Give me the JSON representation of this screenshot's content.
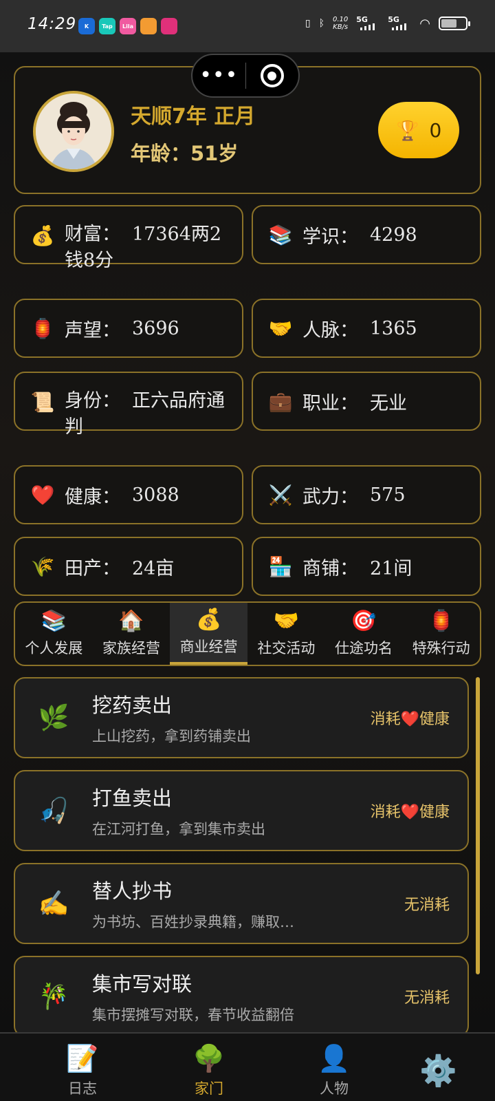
{
  "status_bar": {
    "time": "14:29",
    "apps": [
      {
        "label": "K",
        "color": "#1a6bd6"
      },
      {
        "label": "Tap",
        "color": "#19c8b9"
      },
      {
        "label": "Lila",
        "color": "#f05aa0"
      },
      {
        "label": "",
        "color": "#f39b32"
      },
      {
        "label": "",
        "color": "#e0307a"
      }
    ],
    "net_speed": "0.10",
    "net_unit": "KB/s",
    "sim1": "5G",
    "sim2": "5G"
  },
  "profile": {
    "date": "天顺7年 正月",
    "age": "年龄：51岁",
    "trophy_count": "0",
    "trophy_icon": "🏆"
  },
  "stats": [
    {
      "icon": "💰",
      "label": "财富：",
      "value": "17364两2钱8分"
    },
    {
      "icon": "📚",
      "label": "学识：",
      "value": "4298"
    },
    {
      "icon": "🏮",
      "label": "声望：",
      "value": "3696"
    },
    {
      "icon": "🤝",
      "label": "人脉：",
      "value": "1365"
    },
    {
      "icon": "📜",
      "label": "身份：",
      "value": "正六品府通判"
    },
    {
      "icon": "💼",
      "label": "职业：",
      "value": "无业"
    },
    {
      "icon": "❤️",
      "label": "健康：",
      "value": "3088"
    },
    {
      "icon": "⚔️",
      "label": "武力：",
      "value": "575"
    },
    {
      "icon": "🌾",
      "label": "田产：",
      "value": "24亩"
    },
    {
      "icon": "🏪",
      "label": "商铺：",
      "value": "21间"
    }
  ],
  "tabs": [
    {
      "icon": "📚",
      "label": "个人发展"
    },
    {
      "icon": "🏠",
      "label": "家族经营"
    },
    {
      "icon": "💰",
      "label": "商业经营"
    },
    {
      "icon": "🤝",
      "label": "社交活动"
    },
    {
      "icon": "🎯",
      "label": "仕途功名"
    },
    {
      "icon": "🏮",
      "label": "特殊行动"
    }
  ],
  "active_tab": "商业经营",
  "actions": [
    {
      "icon": "🌿",
      "title": "挖药卖出",
      "desc": "上山挖药，拿到药铺卖出",
      "cost": "消耗❤️健康"
    },
    {
      "icon": "🎣",
      "title": "打鱼卖出",
      "desc": "在江河打鱼，拿到集市卖出",
      "cost": "消耗❤️健康"
    },
    {
      "icon": "✍️",
      "title": "替人抄书",
      "desc": "为书坊、百姓抄录典籍，赚取…",
      "cost": "无消耗"
    },
    {
      "icon": "🎋",
      "title": "集市写对联",
      "desc": "集市摆摊写对联，春节收益翻倍",
      "cost": "无消耗"
    }
  ],
  "bottom_nav": [
    {
      "icon": "📝",
      "label": "日志"
    },
    {
      "icon": "🌳",
      "label": "家门"
    },
    {
      "icon": "👤",
      "label": "人物"
    }
  ],
  "settings_icon": "⚙️",
  "colors": {
    "accent": "#d4a82e",
    "border": "#8b7228",
    "trophy": "#ffc61a"
  }
}
